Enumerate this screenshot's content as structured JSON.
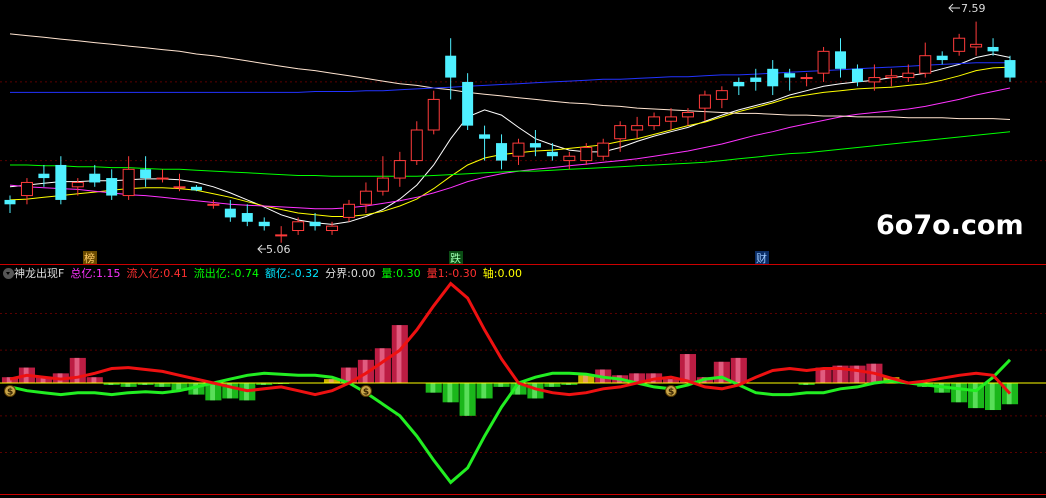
{
  "watermark": "6o7o.com",
  "price_labels": {
    "high": "7.59",
    "low": "5.06"
  },
  "event_markers": [
    "榜",
    "跌",
    "财"
  ],
  "indicator": {
    "name": "神龙出现F",
    "fields": [
      {
        "label": "总亿:",
        "value": "1.15",
        "color": "#ff33ff"
      },
      {
        "label": "流入亿:",
        "value": "0.41",
        "color": "#ff3030"
      },
      {
        "label": "流出亿:",
        "value": "-0.74",
        "color": "#00ff00"
      },
      {
        "label": "额亿:",
        "value": "-0.32",
        "color": "#00e5ff"
      },
      {
        "label": "分界:",
        "value": "0.00",
        "color": "#dddddd"
      },
      {
        "label": "量:",
        "value": "0.30",
        "color": "#00ff00"
      },
      {
        "label": "量1:",
        "value": "-0.30",
        "color": "#ff3030"
      },
      {
        "label": "轴:",
        "value": "0.00",
        "color": "#ffff00"
      }
    ]
  },
  "chart_data": {
    "type": "candlestick+indicator",
    "price_panel": {
      "ylim": [
        5.0,
        7.7
      ],
      "annotations": [
        {
          "text": "7.59",
          "type": "high"
        },
        {
          "text": "5.06",
          "type": "low"
        }
      ],
      "candles": [
        [
          5.55,
          5.6,
          5.4,
          5.5
        ],
        [
          5.6,
          5.8,
          5.5,
          5.75
        ],
        [
          5.85,
          5.95,
          5.7,
          5.8
        ],
        [
          5.95,
          6.05,
          5.5,
          5.55
        ],
        [
          5.7,
          5.8,
          5.6,
          5.75
        ],
        [
          5.85,
          5.95,
          5.7,
          5.75
        ],
        [
          5.8,
          5.9,
          5.55,
          5.6
        ],
        [
          5.6,
          6.05,
          5.55,
          5.9
        ],
        [
          5.9,
          6.05,
          5.7,
          5.8
        ],
        [
          5.8,
          5.9,
          5.75,
          5.8
        ],
        [
          5.7,
          5.85,
          5.65,
          5.7
        ],
        [
          5.7,
          5.72,
          5.65,
          5.66
        ],
        [
          5.5,
          5.55,
          5.45,
          5.5
        ],
        [
          5.45,
          5.55,
          5.3,
          5.35
        ],
        [
          5.4,
          5.5,
          5.25,
          5.3
        ],
        [
          5.3,
          5.35,
          5.2,
          5.25
        ],
        [
          5.15,
          5.25,
          5.06,
          5.15
        ],
        [
          5.2,
          5.35,
          5.15,
          5.3
        ],
        [
          5.3,
          5.4,
          5.2,
          5.25
        ],
        [
          5.2,
          5.3,
          5.15,
          5.25
        ],
        [
          5.35,
          5.55,
          5.3,
          5.5
        ],
        [
          5.5,
          5.75,
          5.4,
          5.65
        ],
        [
          5.65,
          6.05,
          5.6,
          5.8
        ],
        [
          5.8,
          6.1,
          5.7,
          6.0
        ],
        [
          6.0,
          6.45,
          5.95,
          6.35
        ],
        [
          6.35,
          6.8,
          6.3,
          6.7
        ],
        [
          7.2,
          7.4,
          6.7,
          6.95
        ],
        [
          6.9,
          7.0,
          6.35,
          6.4
        ],
        [
          6.3,
          6.4,
          6.0,
          6.25
        ],
        [
          6.2,
          6.3,
          5.9,
          6.0
        ],
        [
          6.05,
          6.25,
          5.95,
          6.2
        ],
        [
          6.2,
          6.35,
          6.05,
          6.15
        ],
        [
          6.1,
          6.2,
          6.0,
          6.05
        ],
        [
          6.0,
          6.1,
          5.9,
          6.05
        ],
        [
          6.0,
          6.2,
          5.95,
          6.15
        ],
        [
          6.05,
          6.25,
          6.0,
          6.2
        ],
        [
          6.25,
          6.45,
          6.1,
          6.4
        ],
        [
          6.35,
          6.5,
          6.25,
          6.4
        ],
        [
          6.4,
          6.55,
          6.35,
          6.5
        ],
        [
          6.45,
          6.6,
          6.35,
          6.5
        ],
        [
          6.5,
          6.6,
          6.4,
          6.55
        ],
        [
          6.6,
          6.8,
          6.45,
          6.75
        ],
        [
          6.7,
          6.85,
          6.6,
          6.8
        ],
        [
          6.9,
          6.95,
          6.75,
          6.85
        ],
        [
          6.95,
          7.05,
          6.8,
          6.9
        ],
        [
          7.05,
          7.15,
          6.75,
          6.85
        ],
        [
          7.0,
          7.05,
          6.8,
          6.95
        ],
        [
          6.95,
          7.0,
          6.85,
          6.95
        ],
        [
          7.0,
          7.3,
          6.9,
          7.25
        ],
        [
          7.25,
          7.4,
          6.95,
          7.05
        ],
        [
          7.05,
          7.1,
          6.85,
          6.9
        ],
        [
          6.9,
          7.1,
          6.8,
          6.95
        ],
        [
          6.95,
          7.05,
          6.85,
          6.97
        ],
        [
          6.95,
          7.1,
          6.9,
          7.0
        ],
        [
          7.0,
          7.35,
          6.95,
          7.2
        ],
        [
          7.2,
          7.25,
          7.1,
          7.15
        ],
        [
          7.25,
          7.45,
          7.2,
          7.4
        ],
        [
          7.3,
          7.59,
          7.2,
          7.33
        ],
        [
          7.3,
          7.4,
          7.2,
          7.25
        ],
        [
          7.15,
          7.2,
          6.9,
          6.95
        ]
      ],
      "ma_lines": [
        {
          "color": "#ffffff",
          "values": [
            5.7,
            5.72,
            5.74,
            5.76,
            5.76,
            5.77,
            5.77,
            5.78,
            5.79,
            5.79,
            5.78,
            5.75,
            5.7,
            5.63,
            5.55,
            5.47,
            5.38,
            5.32,
            5.29,
            5.27,
            5.3,
            5.36,
            5.44,
            5.56,
            5.72,
            5.95,
            6.25,
            6.5,
            6.58,
            6.52,
            6.38,
            6.25,
            6.18,
            6.12,
            6.1,
            6.1,
            6.15,
            6.22,
            6.28,
            6.33,
            6.38,
            6.45,
            6.52,
            6.58,
            6.63,
            6.68,
            6.75,
            6.8,
            6.85,
            6.88,
            6.9,
            6.92,
            6.95,
            6.97,
            7.0,
            7.05,
            7.1,
            7.18,
            7.22,
            7.18
          ]
        },
        {
          "color": "#ffff00",
          "values": [
            5.55,
            5.56,
            5.58,
            5.6,
            5.62,
            5.64,
            5.66,
            5.68,
            5.69,
            5.69,
            5.68,
            5.66,
            5.62,
            5.58,
            5.53,
            5.48,
            5.44,
            5.4,
            5.38,
            5.36,
            5.36,
            5.38,
            5.42,
            5.48,
            5.56,
            5.68,
            5.82,
            5.95,
            6.03,
            6.07,
            6.09,
            6.11,
            6.12,
            6.14,
            6.16,
            6.18,
            6.22,
            6.25,
            6.3,
            6.35,
            6.4,
            6.44,
            6.5,
            6.56,
            6.61,
            6.66,
            6.72,
            6.75,
            6.78,
            6.8,
            6.82,
            6.83,
            6.84,
            6.86,
            6.88,
            6.92,
            6.97,
            7.03,
            7.06,
            7.07
          ]
        },
        {
          "color": "#ff33ff",
          "values": [
            5.72,
            5.7,
            5.69,
            5.68,
            5.67,
            5.65,
            5.63,
            5.61,
            5.6,
            5.58,
            5.56,
            5.54,
            5.52,
            5.5,
            5.49,
            5.48,
            5.47,
            5.46,
            5.45,
            5.45,
            5.46,
            5.48,
            5.51,
            5.54,
            5.58,
            5.63,
            5.69,
            5.76,
            5.81,
            5.85,
            5.88,
            5.9,
            5.92,
            5.94,
            5.96,
            5.98,
            6.0,
            6.02,
            6.05,
            6.08,
            6.11,
            6.15,
            6.19,
            6.24,
            6.29,
            6.33,
            6.38,
            6.42,
            6.46,
            6.5,
            6.53,
            6.55,
            6.57,
            6.59,
            6.62,
            6.66,
            6.7,
            6.75,
            6.79,
            6.83
          ]
        },
        {
          "color": "#00ff00",
          "values": [
            5.95,
            5.95,
            5.94,
            5.94,
            5.93,
            5.93,
            5.92,
            5.92,
            5.91,
            5.9,
            5.9,
            5.89,
            5.88,
            5.87,
            5.86,
            5.85,
            5.84,
            5.83,
            5.83,
            5.82,
            5.82,
            5.82,
            5.82,
            5.82,
            5.82,
            5.83,
            5.84,
            5.85,
            5.86,
            5.87,
            5.88,
            5.88,
            5.89,
            5.9,
            5.91,
            5.92,
            5.93,
            5.94,
            5.95,
            5.96,
            5.97,
            5.98,
            6.0,
            6.02,
            6.04,
            6.06,
            6.08,
            6.09,
            6.11,
            6.13,
            6.15,
            6.17,
            6.19,
            6.21,
            6.23,
            6.25,
            6.27,
            6.29,
            6.31,
            6.33
          ]
        },
        {
          "color": "#ffe4d0",
          "values": [
            7.45,
            7.43,
            7.41,
            7.39,
            7.37,
            7.35,
            7.33,
            7.31,
            7.29,
            7.27,
            7.25,
            7.22,
            7.2,
            7.17,
            7.14,
            7.11,
            7.08,
            7.05,
            7.03,
            7.0,
            6.97,
            6.94,
            6.91,
            6.88,
            6.86,
            6.83,
            6.81,
            6.78,
            6.76,
            6.74,
            6.72,
            6.7,
            6.68,
            6.66,
            6.65,
            6.63,
            6.62,
            6.6,
            6.59,
            6.58,
            6.57,
            6.56,
            6.55,
            6.54,
            6.54,
            6.53,
            6.52,
            6.52,
            6.51,
            6.51,
            6.5,
            6.5,
            6.5,
            6.49,
            6.49,
            6.49,
            6.48,
            6.48,
            6.48,
            6.47
          ]
        },
        {
          "color": "#2233ff",
          "values": [
            6.78,
            6.78,
            6.78,
            6.78,
            6.78,
            6.78,
            6.78,
            6.78,
            6.78,
            6.78,
            6.78,
            6.78,
            6.78,
            6.78,
            6.78,
            6.78,
            6.78,
            6.78,
            6.79,
            6.79,
            6.79,
            6.8,
            6.8,
            6.81,
            6.82,
            6.83,
            6.84,
            6.85,
            6.86,
            6.87,
            6.88,
            6.89,
            6.9,
            6.91,
            6.92,
            6.93,
            6.93,
            6.94,
            6.95,
            6.96,
            6.96,
            6.97,
            6.98,
            6.98,
            6.99,
            7.0,
            7.01,
            7.02,
            7.03,
            7.04,
            7.05,
            7.06,
            7.07,
            7.08,
            7.09,
            7.1,
            7.11,
            7.12,
            7.12,
            7.12
          ]
        }
      ]
    },
    "indicator_panel": {
      "ylim": [
        -1.15,
        1.15
      ],
      "red_line": [
        0.04,
        0.08,
        0.06,
        0.04,
        0.06,
        0.1,
        0.15,
        0.16,
        0.14,
        0.12,
        0.08,
        0.04,
        0.0,
        -0.04,
        -0.08,
        -0.06,
        -0.04,
        -0.08,
        -0.12,
        -0.08,
        0.0,
        0.1,
        0.22,
        0.34,
        0.55,
        0.8,
        1.03,
        0.88,
        0.55,
        0.25,
        0.0,
        -0.06,
        -0.1,
        -0.12,
        -0.1,
        -0.06,
        -0.04,
        0.0,
        0.04,
        0.06,
        0.02,
        -0.04,
        -0.06,
        -0.02,
        0.06,
        0.13,
        0.15,
        0.13,
        0.15,
        0.15,
        0.13,
        0.1,
        0.05,
        0.0,
        0.02,
        0.05,
        0.08,
        0.1,
        0.08,
        -0.11
      ],
      "green_line": [
        -0.04,
        -0.08,
        -0.1,
        -0.12,
        -0.1,
        -0.1,
        -0.12,
        -0.1,
        -0.09,
        -0.1,
        -0.08,
        -0.04,
        0.0,
        0.04,
        0.08,
        0.1,
        0.09,
        0.08,
        0.08,
        0.06,
        0.0,
        -0.1,
        -0.22,
        -0.34,
        -0.55,
        -0.8,
        -1.03,
        -0.88,
        -0.55,
        -0.25,
        0.0,
        0.06,
        0.1,
        0.1,
        0.09,
        0.06,
        0.04,
        0.0,
        -0.04,
        -0.06,
        -0.02,
        0.04,
        0.06,
        -0.02,
        -0.1,
        -0.12,
        -0.12,
        -0.1,
        -0.1,
        -0.06,
        -0.04,
        0.0,
        0.02,
        0.0,
        -0.02,
        -0.04,
        -0.06,
        -0.08,
        0.06,
        0.24
      ],
      "bars": [
        0.06,
        0.16,
        0.06,
        0.1,
        0.26,
        0.06,
        -0.02,
        -0.04,
        -0.02,
        -0.04,
        -0.08,
        -0.12,
        -0.18,
        -0.16,
        -0.18,
        -0.02,
        -0.01,
        0.0,
        0.0,
        0.04,
        0.16,
        0.24,
        0.36,
        0.6,
        0.0,
        -0.1,
        -0.2,
        -0.34,
        -0.16,
        -0.04,
        -0.12,
        -0.16,
        -0.04,
        -0.02,
        0.08,
        0.14,
        0.08,
        0.1,
        0.1,
        0.04,
        0.3,
        0.06,
        0.22,
        0.26,
        0.0,
        0.0,
        0.0,
        -0.02,
        0.16,
        0.18,
        0.18,
        0.2,
        0.06,
        0.0,
        -0.04,
        -0.1,
        -0.2,
        -0.26,
        -0.28,
        -0.22
      ],
      "signals": [
        0,
        21,
        39
      ]
    }
  }
}
